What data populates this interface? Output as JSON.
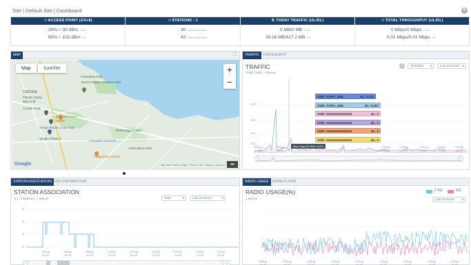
{
  "breadcrumb": "Site | Default Site | Dashboard",
  "summary": [
    {
      "title": "↑/ ACCESS POINT (2/3+8)",
      "line1": "30% / -30 dBm",
      "unit1": "2.4G",
      "line2": "60% / -102 dBm",
      "unit2": "5G"
    },
    {
      "title": "↑/ STATIONS : 1",
      "line1": "30",
      "unit1": "AVG devices/hr",
      "line2": "43",
      "unit2": "MAX devices/hr"
    },
    {
      "title": "⇅ TODAY TRAFFIC (UL/DL)",
      "line1": "0 MB/0 MB",
      "unit1": "2.4G",
      "line2": "29.18 MB/417.2 MB",
      "unit2": "5G"
    },
    {
      "title": "↑/ TOTAL THROUGHPUT (UL/DL)",
      "line1": "0 Mbps/0 Mbps",
      "unit1": "2.4G",
      "line2": "0.01 Mbps/0.01 Mbps",
      "unit2": "5G"
    }
  ],
  "map": {
    "tab": "MAP",
    "expand_icon": "⛶",
    "type_map": "Map",
    "type_satellite": "Satellite",
    "zoom_in": "+",
    "zoom_out": "−",
    "google": "Google",
    "attribution": "Map data ©2025 Google | Terms of Use | Report a map error",
    "labels": [
      {
        "text": "Friendship Park",
        "cls": "",
        "x": 138,
        "y": 16
      },
      {
        "text": "Ahom's Nature Reserve Park",
        "cls": "",
        "x": 118,
        "y": 39
      },
      {
        "text": "CitiZONE",
        "cls": "",
        "x": 18,
        "y": 108
      },
      {
        "text": "Fitness Camp",
        "cls": "",
        "x": 18,
        "y": 120
      },
      {
        "text": "Microsoft",
        "cls": "",
        "x": 18,
        "y": 128
      },
      {
        "text": "Arcade Pride",
        "cls": "",
        "x": 18,
        "y": 141
      },
      {
        "text": "Mansion Stone",
        "cls": "orange",
        "x": 76,
        "y": 168
      },
      {
        "text": "Aonae",
        "cls": "orange",
        "x": 76,
        "y": 175
      },
      {
        "text": "Simple Phase 1 Car Park",
        "cls": "blue",
        "x": 54,
        "y": 183
      },
      {
        "text": "Simple Phase 3",
        "cls": "",
        "x": 54,
        "y": 204
      },
      {
        "text": "Innovation Orchard",
        "cls": "blue",
        "x": 130,
        "y": 203
      },
      {
        "text": "Happiness Cuisine",
        "cls": "orange",
        "x": 137,
        "y": 224
      },
      {
        "text": "Technology Centre",
        "cls": "",
        "x": 184,
        "y": 186
      },
      {
        "text": "Information Park",
        "cls": "",
        "x": 196,
        "y": 214
      }
    ]
  },
  "traffic": {
    "tabs": [
      "TRAFFIC",
      "THROUGHPUT"
    ],
    "title": "TRAFFIC",
    "subtitle": "Traffic (MB) / 1 Minute",
    "filter1": "All SSIDs",
    "filter2": "Last 24 Hours",
    "tooltip": "Mon, Aug 26 2024 16:30",
    "legend": [
      {
        "label": "SSID: AORA_UML",
        "value": "DL: 0.272",
        "color": "#6b8bd8"
      },
      {
        "label": "SSID: AORA_UML",
        "value": "DL: 0.257",
        "color": "#a3cae9"
      },
      {
        "label": "SSID: ≤≤≤≤≤≤≤≤≤≤≤≤≤≤≤",
        "value": "UL: 0",
        "color": "#f2c0d6"
      },
      {
        "label": "SSID: ≤≤≤≤≤≤≤≤≤≤≤≤≤≤≤",
        "value": "DL: 0",
        "color": "#b9a6e3"
      },
      {
        "label": "SSID: ≤≤≤≤≤≤≤≤≤≤≤≤≤≤≤",
        "value": "UL: 0",
        "color": "#f4a373"
      },
      {
        "label": "SSID: ≤≤≤≤≤≤≤≤≤≤≤≤≤≤≤",
        "value": "UL: 0",
        "color": "#f6da75"
      }
    ],
    "yticks": [
      "0.8",
      "0.6",
      "0.4",
      "0.2",
      "0"
    ],
    "xticks": [
      "26Aug 16:30",
      "26Aug 19:30",
      "26Aug 22:30",
      "27Aug 01:30",
      "27Aug 04:30",
      "27Aug 07:30",
      "27Aug 10:30",
      "27Aug 13:30",
      "27Aug 16:30"
    ]
  },
  "station": {
    "tabs": [
      "STATION ASSOCIATION",
      "RSSI DISTRIBUTION"
    ],
    "title": "STATION ASSOCIATION",
    "subtitle": "No. of Stations / 1 Minute",
    "filter1": "Total",
    "filter2": "Last 24 Hours",
    "yticks": [
      "3",
      "2",
      "1",
      "0"
    ],
    "xticks": [
      "26Aug 16:30",
      "26Aug 19:30",
      "26Aug 22:30",
      "27Aug 01:30",
      "27Aug 04:30",
      "27Aug 07:30",
      "27Aug 10:30",
      "27Aug 13:30",
      "27Aug 16:30"
    ]
  },
  "radio": {
    "tabs": [
      "RADIO USAGE",
      "NOISE FLOOR"
    ],
    "title": "RADIO USAGE(%)",
    "subtitle": "1 Minute",
    "legend_24": "2.4G",
    "legend_5": "5G",
    "filter2": "Last 24 Hours",
    "xticks": [
      "26Aug 16:30",
      "26Aug 19:30",
      "26Aug 22:30",
      "27Aug 01:30",
      "27Aug 04:30",
      "27Aug 07:30",
      "27Aug 10:30",
      "27Aug 13:30",
      "27Aug 16:30"
    ]
  },
  "colors": {
    "navy": "#1b3f66",
    "pink": "#ef7fae",
    "blue": "#6ec6f0"
  }
}
